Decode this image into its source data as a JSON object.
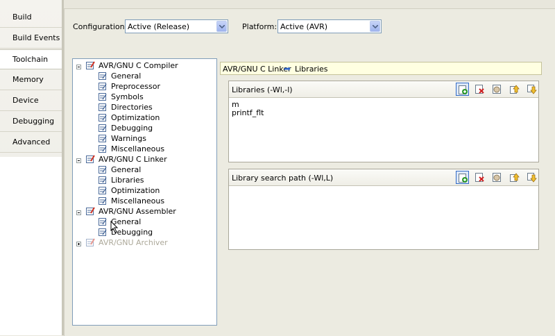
{
  "sidebar": {
    "tabs": [
      {
        "label": "Build",
        "active": false
      },
      {
        "label": "Build Events",
        "active": false
      },
      {
        "label": "Toolchain",
        "active": true
      },
      {
        "label": "Memory",
        "active": false
      },
      {
        "label": "Device",
        "active": false
      },
      {
        "label": "Debugging",
        "active": false
      },
      {
        "label": "Advanced",
        "active": false
      }
    ]
  },
  "config": {
    "configuration_label": "Configuration:",
    "configuration_value": "Active (Release)",
    "platform_label": "Platform:",
    "platform_value": "Active (AVR)"
  },
  "tree": {
    "groups": [
      {
        "label": "AVR/GNU C Compiler",
        "expanded": true,
        "children": [
          "General",
          "Preprocessor",
          "Symbols",
          "Directories",
          "Optimization",
          "Debugging",
          "Warnings",
          "Miscellaneous"
        ]
      },
      {
        "label": "AVR/GNU C Linker",
        "expanded": true,
        "children": [
          "General",
          "Libraries",
          "Optimization",
          "Miscellaneous"
        ]
      },
      {
        "label": "AVR/GNU Assembler",
        "expanded": true,
        "children": [
          "General",
          "Debugging"
        ]
      },
      {
        "label": "AVR/GNU Archiver",
        "expanded": false,
        "children": []
      }
    ],
    "selected": "Libraries"
  },
  "breadcrumb": {
    "parent": "AVR/GNU C Linker",
    "arrow": "➡",
    "current": "Libraries"
  },
  "libraries": {
    "title": "Libraries (-Wl,-l)",
    "items": [
      "m",
      "printf_flt"
    ]
  },
  "search_path": {
    "title": "Library search path (-Wl,L)",
    "items": []
  },
  "toolbar_icons": [
    "add-item-icon",
    "delete-item-icon",
    "edit-item-icon",
    "move-up-icon",
    "move-down-icon"
  ],
  "colors": {
    "accent": "#316ac5",
    "panel_bg": "#ecebe1",
    "breadcrumb_bg": "#ffffe1"
  }
}
